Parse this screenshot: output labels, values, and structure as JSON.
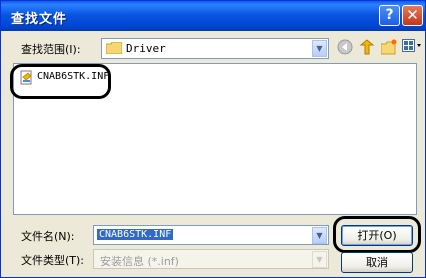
{
  "window": {
    "title": "查找文件"
  },
  "title_buttons": {
    "help": "?",
    "close": "✕"
  },
  "look_in": {
    "label": "查找范围(I):",
    "value": "Driver"
  },
  "toolbar": {
    "back_icon": "back-icon",
    "up_icon": "up-folder-icon",
    "new_folder_icon": "new-folder-icon",
    "views_icon": "views-menu-icon"
  },
  "file_list": {
    "items": [
      {
        "name": "CNAB6STK.INF"
      }
    ]
  },
  "file_name": {
    "label": "文件名(N):",
    "value": "CNAB6STK.INF"
  },
  "file_type": {
    "label": "文件类型(T):",
    "value": "安装信息 (*.inf)"
  },
  "buttons": {
    "open": "打开(O)",
    "cancel": "取消"
  }
}
